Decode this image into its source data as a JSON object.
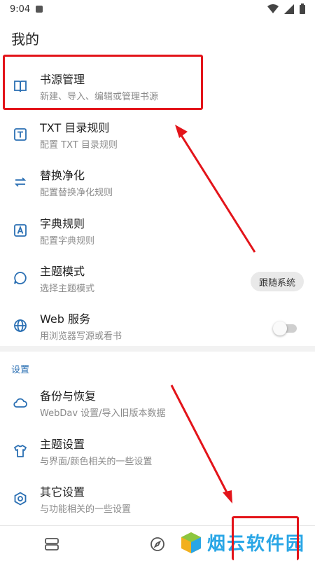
{
  "status_bar": {
    "time": "9:04"
  },
  "page": {
    "title": "我的"
  },
  "items": [
    {
      "title": "书源管理",
      "subtitle": "新建、导入、编辑或管理书源",
      "icon": "book-open-icon"
    },
    {
      "title": "TXT 目录规则",
      "subtitle": "配置 TXT 目录规则",
      "icon": "txt-t-icon"
    },
    {
      "title": "替换净化",
      "subtitle": "配置替换净化规则",
      "icon": "swap-arrows-icon"
    },
    {
      "title": "字典规则",
      "subtitle": "配置字典规则",
      "icon": "dictionary-a-icon"
    },
    {
      "title": "主题模式",
      "subtitle": "选择主题模式",
      "icon": "chat-bubble-icon",
      "value": "跟随系统"
    },
    {
      "title": "Web 服务",
      "subtitle": "用浏览器写源或看书",
      "icon": "globe-icon",
      "toggle_on": false
    }
  ],
  "settings": {
    "label": "设置",
    "items": [
      {
        "title": "备份与恢复",
        "subtitle": "WebDav 设置/导入旧版本数据",
        "icon": "cloud-icon"
      },
      {
        "title": "主题设置",
        "subtitle": "与界面/颜色相关的一些设置",
        "icon": "shirt-icon"
      },
      {
        "title": "其它设置",
        "subtitle": "与功能相关的一些设置",
        "icon": "hexagon-gear-icon"
      }
    ]
  },
  "bottom_nav": [
    "bookshelf-icon",
    "compass-icon"
  ],
  "watermark": {
    "text": "烟云软件园"
  },
  "colors": {
    "accent": "#2a6fb3",
    "annotation": "#e3141a",
    "watermark": "#29a6e6"
  }
}
